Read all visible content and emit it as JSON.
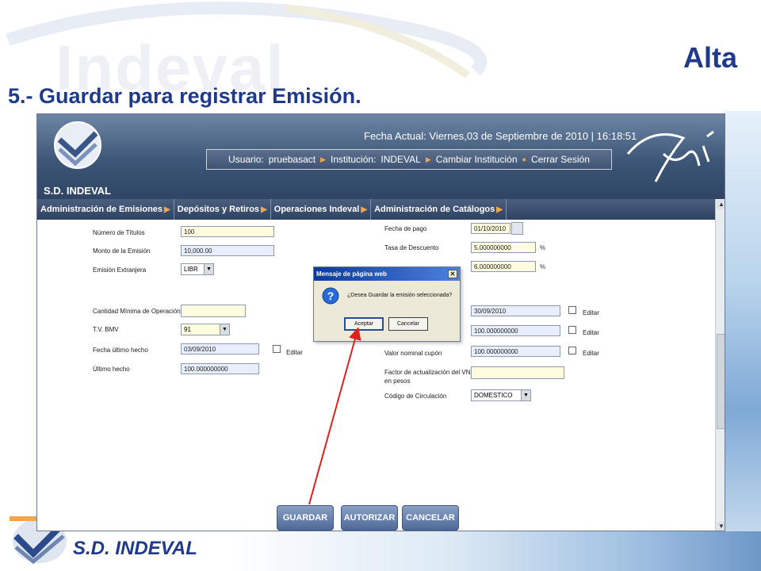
{
  "slide": {
    "title": "Alta",
    "subtitle": "5.- Guardar para registrar Emisión.",
    "watermark": "Indeval",
    "footer_brand": "S.D. INDEVAL"
  },
  "app": {
    "brand": "S.D. INDEVAL",
    "date_line": "Fecha Actual: Viernes,03 de Septiembre de 2010 | 16:18:51",
    "user_label": "Usuario:",
    "user_value": "pruebasact",
    "institution_label": "Institución:",
    "institution_value": "INDEVAL",
    "change_institution": "Cambiar Institución",
    "logout": "Cerrar Sesión",
    "menu": [
      "Administración de Emisiones",
      "Depósitos y Retiros",
      "Operaciones Indeval",
      "Administración de Catálogos"
    ]
  },
  "form": {
    "left": {
      "numero_titulos_label": "Número de Títulos",
      "numero_titulos_value": "100",
      "monto_emision_label": "Monto de la Emisión",
      "monto_emision_value": "10,000.00",
      "emision_extranjera_label": "Emisión Extranjera",
      "emision_extranjera_value": "LIBR",
      "cantidad_minima_label": "Cantidad Mínima de Operación",
      "cantidad_minima_value": "",
      "tv_bmv_label": "T.V. BMV",
      "tv_bmv_value": "91",
      "fecha_ultimo_label": "Fecha último hecho",
      "fecha_ultimo_value": "03/09/2010",
      "editar_label": "Editar",
      "ultimo_hecho_label": "Último hecho",
      "ultimo_hecho_value": "100.000000000"
    },
    "right": {
      "fecha_pago_label": "Fecha de pago",
      "fecha_pago_value": "01/10/2010",
      "tasa_descuento_label": "Tasa de Descuento",
      "tasa_descuento_value": "5.000000000",
      "tasa2_value": "6.000000000",
      "pct": "%",
      "fecha2_value": "30/09/2010",
      "valor1_value": "100.000000000",
      "valor_nominal_label": "Valor nominal cupón",
      "valor_nominal_value": "100.000000000",
      "factor_label_1": "Factor de actualización del VN",
      "factor_label_2": "en pesos",
      "factor_value": "",
      "codigo_label": "Código de Circulación",
      "codigo_value": "DOMESTICO",
      "editar_label": "Editar"
    }
  },
  "buttons": {
    "guardar": "GUARDAR",
    "autorizar": "AUTORIZAR",
    "cancelar": "CANCELAR"
  },
  "dialog": {
    "title": "Mensaje de página web",
    "message": "¿Desea Guardar la emisión seleccionada?",
    "ok": "Aceptar",
    "cancel": "Cancelar"
  },
  "colors": {
    "title_blue": "#1f3a8a",
    "header_dark": "#2f4565",
    "accent_orange": "#f2a54a",
    "arrow_red": "#e02020"
  }
}
